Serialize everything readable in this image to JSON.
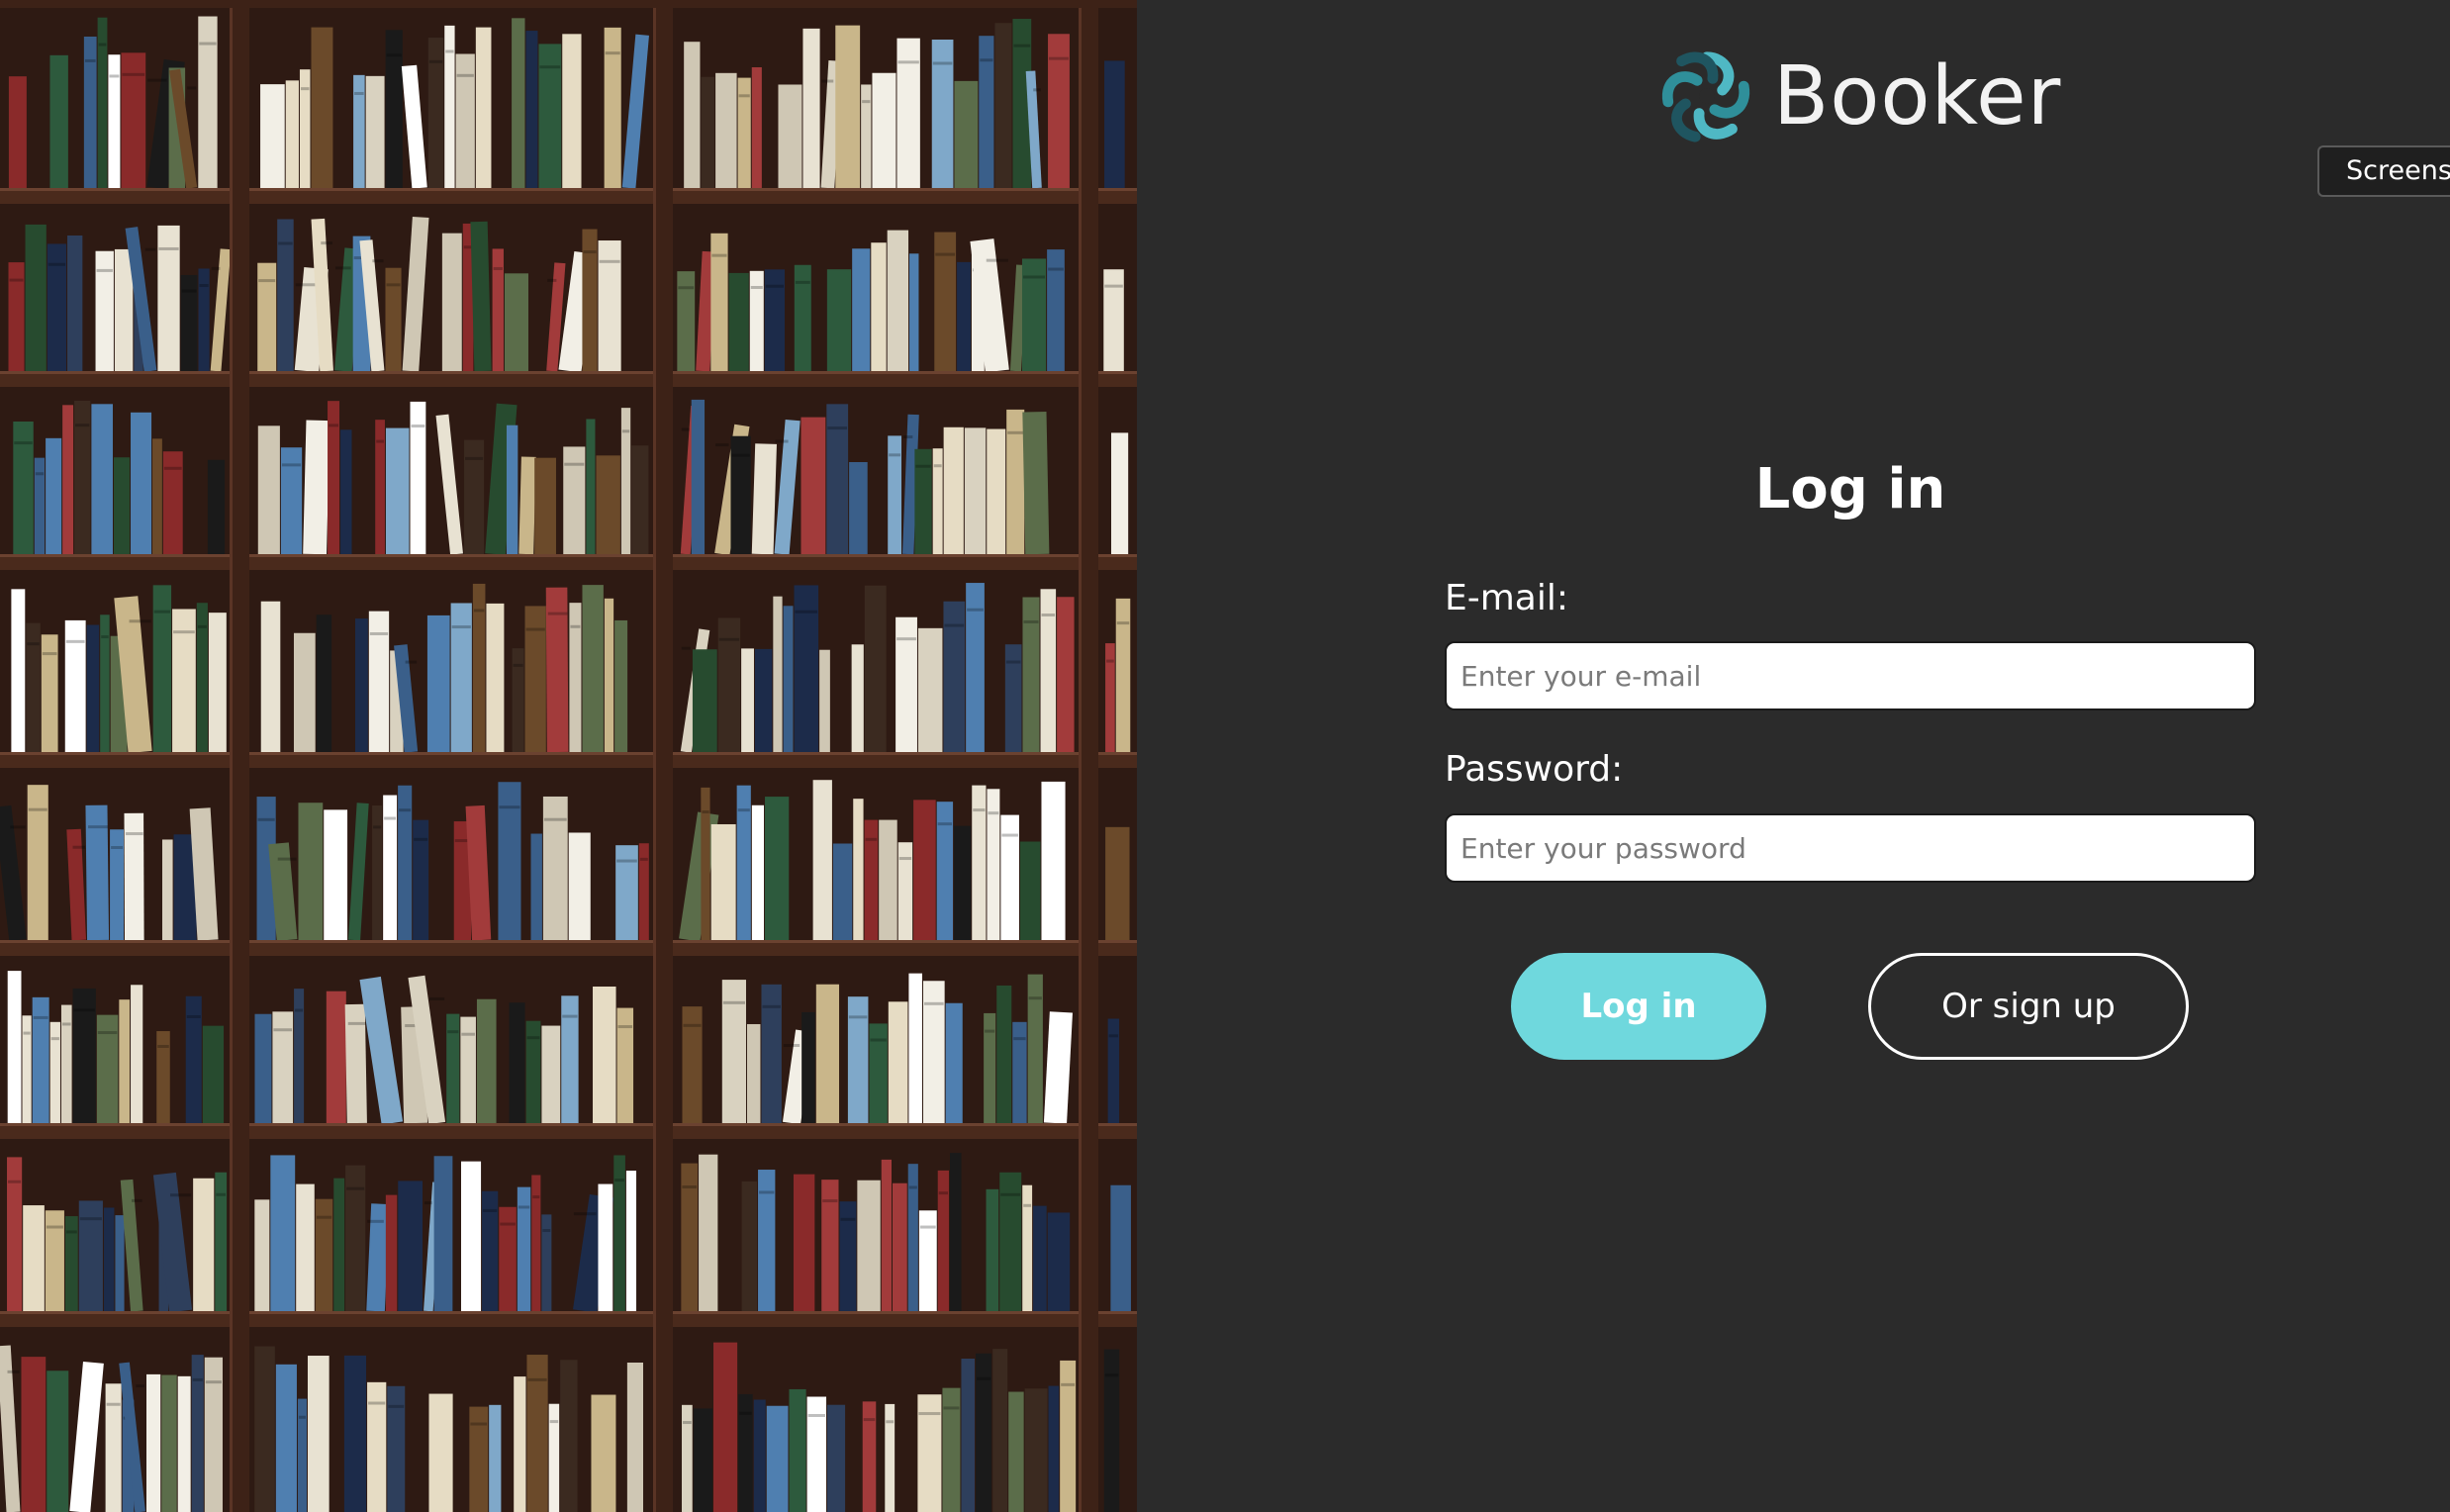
{
  "brand": {
    "name": "Booker",
    "logo_icon": "knot-logo-icon",
    "logo_colors": [
      "#2f8f9a",
      "#4fb8c4",
      "#1f5560"
    ]
  },
  "floating_tab": {
    "label": "Screens"
  },
  "login": {
    "title": "Log in",
    "email": {
      "label": "E-mail:",
      "placeholder": "Enter your e-mail",
      "value": ""
    },
    "password": {
      "label": "Password:",
      "placeholder": "Enter your password",
      "value": ""
    },
    "login_button": "Log in",
    "signup_button": "Or sign up"
  },
  "background_image": {
    "subject": "library bookshelf photo"
  },
  "colors": {
    "panel_background": "#2b2b2b",
    "accent": "#6fd8dd",
    "text": "#ffffff"
  }
}
